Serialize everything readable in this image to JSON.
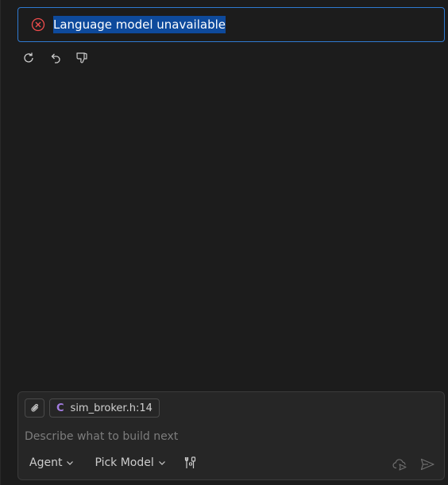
{
  "error": {
    "message": "Language model unavailable",
    "icon": "error-circle-icon",
    "color": "#f14c4c"
  },
  "actions": [
    {
      "name": "retry-button",
      "icon": "refresh-icon"
    },
    {
      "name": "undo-button",
      "icon": "undo-icon"
    },
    {
      "name": "thumbs-down-button",
      "icon": "thumbs-down-icon"
    }
  ],
  "composer": {
    "attach_icon": "paperclip-icon",
    "context_chip": {
      "icon_glyph": "C",
      "label": "sim_broker.h:14"
    },
    "placeholder": "Describe what to build next",
    "mode_label": "Agent",
    "model_label": "Pick Model",
    "tools_icon": "tools-icon",
    "delegate_icon": "cloud-send-icon",
    "send_icon": "send-icon"
  },
  "colors": {
    "background": "#1c1c1c",
    "focus_border": "#2f7ad1",
    "selection": "#0e4a9c",
    "chip_accent": "#a27ce0"
  }
}
